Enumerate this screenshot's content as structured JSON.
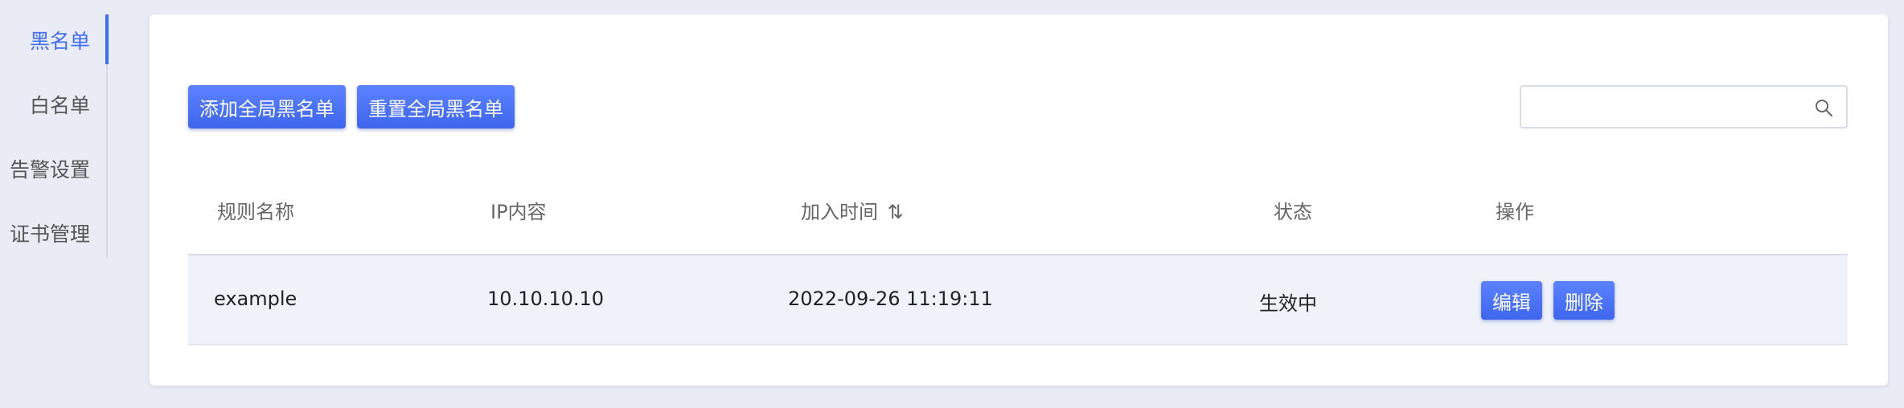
{
  "sidebar": {
    "items": [
      {
        "label": "黑名单",
        "active": true
      },
      {
        "label": "白名单"
      },
      {
        "label": "告警设置"
      },
      {
        "label": "证书管理"
      }
    ]
  },
  "toolbar": {
    "add_label": "添加全局黑名单",
    "reset_label": "重置全局黑名单",
    "search_placeholder": ""
  },
  "table": {
    "columns": [
      "规则名称",
      "IP内容",
      "加入时间",
      "状态",
      "操作"
    ],
    "sort_glyph": "⇅",
    "rows": [
      {
        "name": "example",
        "ip": "10.10.10.10",
        "time": "2022-09-26 11:19:11",
        "status": "生效中",
        "edit_label": "编辑",
        "delete_label": "删除"
      }
    ]
  },
  "colors": {
    "accent": "#3e6ef5",
    "background": "#e9ecf4",
    "row_bg": "#f0f2fa"
  },
  "icons": [
    "search-icon",
    "sort-icon"
  ]
}
